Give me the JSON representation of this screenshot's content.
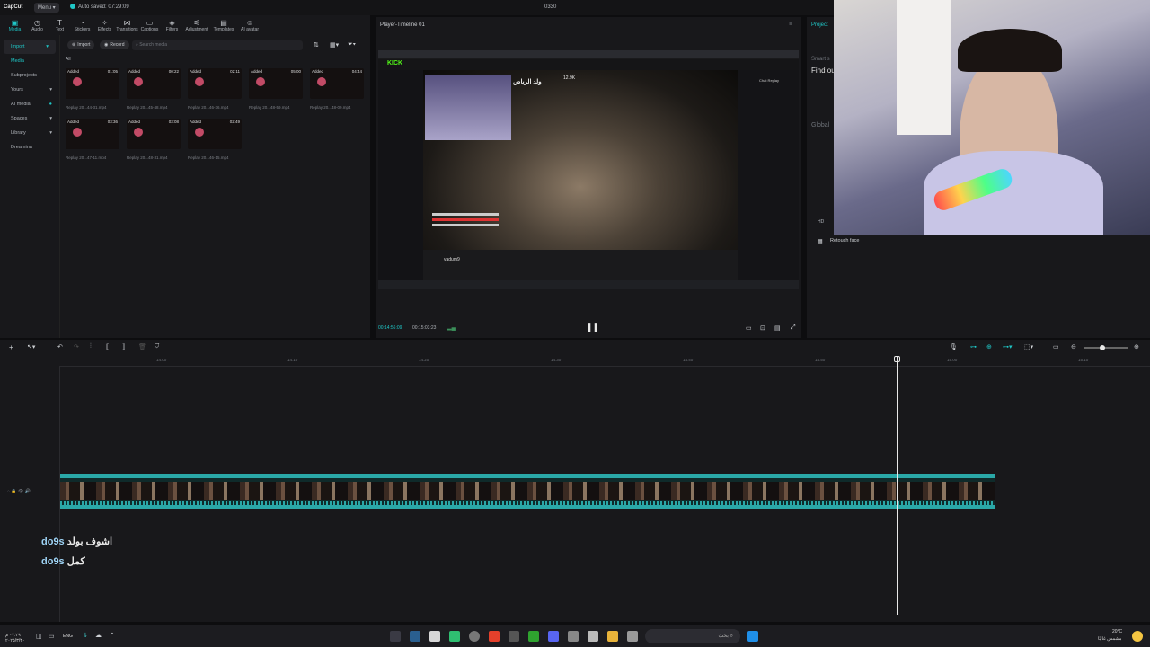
{
  "titlebar": {
    "app": "CapCut",
    "menu": "Menu",
    "autosave": "Auto saved: 07:29:09",
    "project_name": "0330"
  },
  "toolbar": {
    "items": [
      "Media",
      "Audio",
      "Text",
      "Stickers",
      "Effects",
      "Transitions",
      "Captions",
      "Filters",
      "Adjustment",
      "Templates",
      "AI avatar"
    ]
  },
  "sidebar": {
    "items": [
      "Import",
      "Media",
      "Subprojects",
      "Yours",
      "AI media",
      "Spaces",
      "Library",
      "Dreamina"
    ]
  },
  "media": {
    "import_label": "Import",
    "record_label": "Record",
    "search_placeholder": "Search media",
    "filter_label": "All",
    "clips": [
      {
        "tag": "Added",
        "duration": "01:05",
        "name": "Replay 20...44-31.mp4"
      },
      {
        "tag": "Added",
        "duration": "00:22",
        "name": "Replay 20...45-48.mp4"
      },
      {
        "tag": "Added",
        "duration": "02:11",
        "name": "Replay 20...46-36.mp4"
      },
      {
        "tag": "Added",
        "duration": "05:00",
        "name": "Replay 20...48-59.mp4"
      },
      {
        "tag": "Added",
        "duration": "04:44",
        "name": "Replay 20...48-09.mp4"
      },
      {
        "tag": "Added",
        "duration": "03:36",
        "name": "Replay 20...47-11.mp4"
      },
      {
        "tag": "Added",
        "duration": "03:08",
        "name": "Replay 20...48-31.mp4"
      },
      {
        "tag": "Added",
        "duration": "02:49",
        "name": "Replay 20...46-15.mp4"
      }
    ]
  },
  "player": {
    "title": "Player-Timeline 01",
    "current_time": "00:14:56:09",
    "total_time": "00:15:03:23",
    "stream": {
      "site": "KICK",
      "streamer_title": "ولد الرياض",
      "viewer_count": "12.9K",
      "channel": "vadum9",
      "chat_header": "Chat Replay"
    }
  },
  "right_panel": {
    "tab": "Project",
    "smart_label": "Smart s",
    "find_label": "Find ou",
    "global_label": "Global",
    "retouch_label": "Retouch face",
    "hd_label": "HD"
  },
  "timeline": {
    "ticks": [
      "14:00",
      "14:10",
      "14:20",
      "14:30",
      "14:40",
      "14:50",
      "15:00",
      "15:10"
    ],
    "captions": [
      {
        "user": "do9s",
        "text": "اشوف بولد"
      },
      {
        "user": "do9s",
        "text": "كمل"
      }
    ]
  },
  "taskbar": {
    "lang": "ENG",
    "search_placeholder": "بحث",
    "temp": "20°C",
    "weather": "مشمس غالبًا",
    "time": "٠٧:٢٩ م",
    "date": "٢٠٢٥/٣/٣٠"
  },
  "colors": {
    "accent": "#1fc7c7",
    "clip": "#2aa8a8",
    "background": "#18181b"
  }
}
